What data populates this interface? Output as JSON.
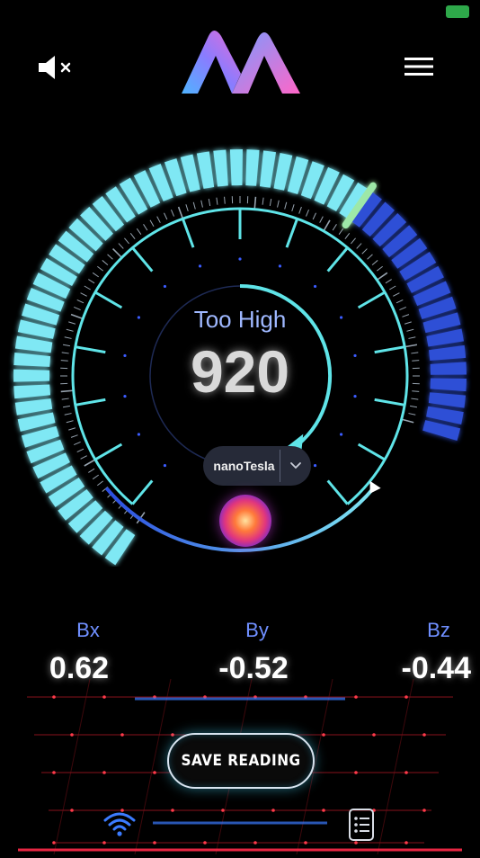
{
  "status_bar": {
    "battery_icon": "battery-charging-icon",
    "battery_text": ""
  },
  "header": {
    "mute_icon": "speaker-muted-icon",
    "logo_icon": "m-gradient-logo",
    "menu_icon": "hamburger-menu-icon"
  },
  "gauge": {
    "status": "Too High",
    "value": "920",
    "level": 0.72,
    "unit": {
      "selected": "nanoTesla",
      "chevron_icon": "chevron-down-icon"
    },
    "orb_icon": "sensor-orb-icon"
  },
  "axes": [
    {
      "label": "Bx",
      "value": "0.62"
    },
    {
      "label": "By",
      "value": "-0.52"
    },
    {
      "label": "Bz",
      "value": "-0.44"
    }
  ],
  "actions": {
    "save_label": "SAVE READING"
  },
  "nav": {
    "wifi_icon": "wifi-icon",
    "history_icon": "list-icon"
  },
  "colors": {
    "segment_active": "#7fe8f4",
    "segment_inactive": "#2f4fd6",
    "dial_ring": "#5fe4e8",
    "status_text": "#9fb8ff",
    "axis_label": "#6f8fff"
  }
}
